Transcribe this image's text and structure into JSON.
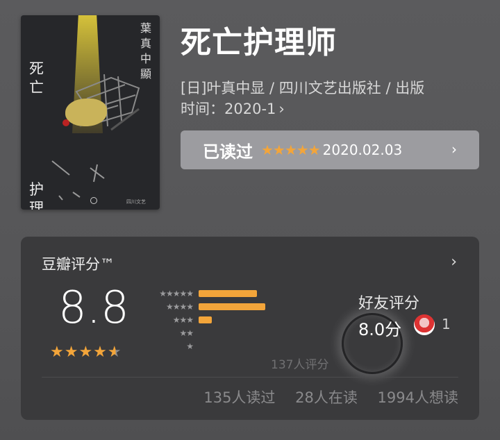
{
  "book": {
    "title": "死亡护理师",
    "meta_line1": "[日]叶真中显 / 四川文艺出版社 / 出版",
    "meta_line2": "时间：2020-1",
    "meta_chevron": "›"
  },
  "cover": {
    "title_top": "死亡",
    "title_bottom": "护理师",
    "author_vertical": "葉真中顯",
    "publisher_small": "四川文艺"
  },
  "read_status": {
    "label": "已读过",
    "stars": "★★★★★",
    "date": "2020.02.03",
    "chevron": "›"
  },
  "rating": {
    "heading": "豆瓣评分™",
    "chevron": "›",
    "score": "8.8",
    "stars_value": 4.5,
    "distribution": [
      {
        "stars": "★★★★★",
        "fraction": 0.88
      },
      {
        "stars": "★★★★",
        "fraction": 1.0
      },
      {
        "stars": "★★★",
        "fraction": 0.2
      },
      {
        "stars": "★★",
        "fraction": 0.0
      },
      {
        "stars": "★",
        "fraction": 0.0
      }
    ],
    "count_text": "137人评分",
    "friend_label": "好友评分",
    "friend_score": "8.0分",
    "friend_count": "1",
    "stats": {
      "read": "135人读过",
      "reading": "28人在读",
      "wish": "1994人想读"
    }
  },
  "colors": {
    "accent": "#f3a53a",
    "card_bg": "#3a3a3c",
    "page_bg": "#565658"
  }
}
